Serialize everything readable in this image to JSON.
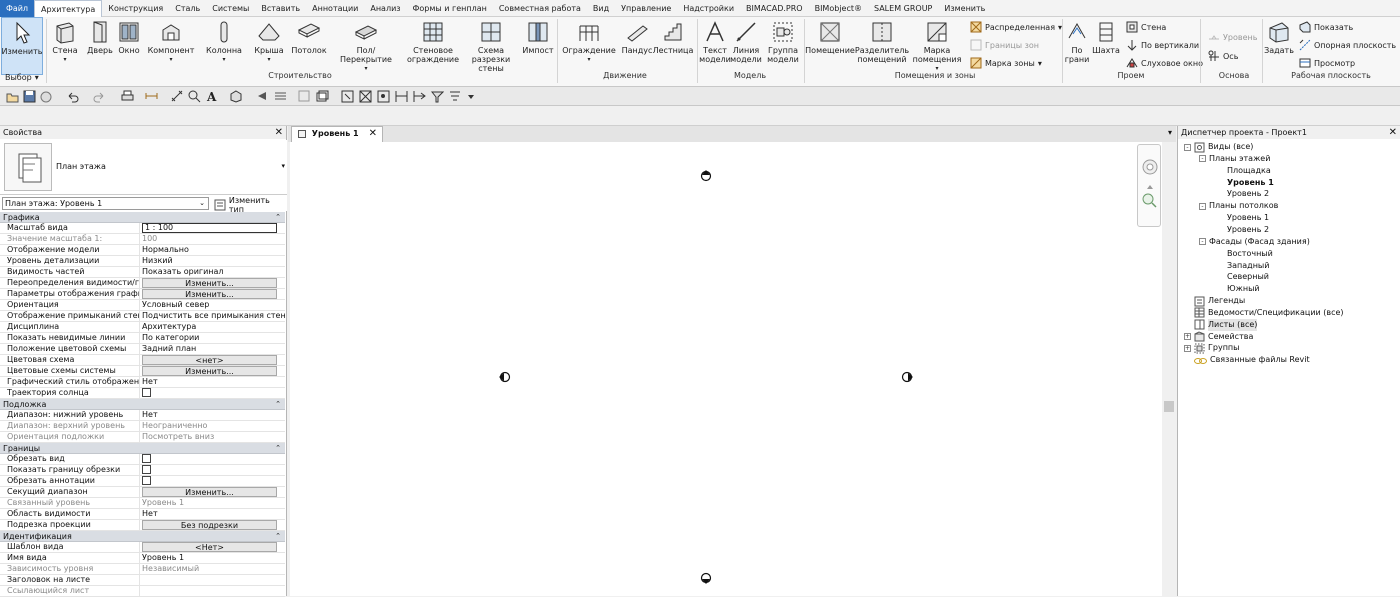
{
  "menu": {
    "file": "Файл",
    "tabs": [
      "Архитектура",
      "Конструкция",
      "Сталь",
      "Системы",
      "Вставить",
      "Аннотации",
      "Анализ",
      "Формы и генплан",
      "Совместная работа",
      "Вид",
      "Управление",
      "Надстройки",
      "BIMACAD.PRO",
      "BIMobject®",
      "SALEM GROUP",
      "Изменить"
    ],
    "active_tab": "Архитектура"
  },
  "ribbon": {
    "modify": "Изменить",
    "select": "Выбор",
    "build": {
      "wall": "Стена",
      "door": "Дверь",
      "window": "Окно",
      "component": "Компонент",
      "column": "Колонна",
      "roof": "Крыша",
      "ceiling": "Потолок",
      "floor": "Пол/Перекрытие",
      "curtain_system": "Стеновое\nограждение",
      "curtain_grid": "Схема разрезки\nстены",
      "mullion": "Импост",
      "panel": "Строительство"
    },
    "circulation": {
      "railing": "Ограждение",
      "ramp": "Пандус",
      "stair": "Лестница",
      "panel": "Движение"
    },
    "model": {
      "model_text": "Текст\nмодели",
      "model_line": "Линия\nмодели",
      "model_group": "Группа\nмодели",
      "panel": "Модель"
    },
    "room": {
      "room": "Помещение",
      "separator": "Разделитель\nпомещений",
      "tag_room": "Марка\nпомещения",
      "area": "Распределенная",
      "area_boundary": "Границы зон",
      "tag_area": "Марка зоны",
      "panel": "Помещения и зоны"
    },
    "opening": {
      "by_face": "По\nграни",
      "shaft": "Шахта",
      "wall": "Стена",
      "vertical": "По вертикали",
      "dormer": "Слуховое окно",
      "panel": "Проем"
    },
    "datum": {
      "level": "Уровень",
      "grid": "Ось",
      "panel": "Основа"
    },
    "workplane": {
      "set": "Задать",
      "show": "Показать",
      "ref_plane": "Опорная плоскость",
      "viewer": "Просмотр",
      "panel": "Рабочая плоскость"
    }
  },
  "properties": {
    "title": "Свойства",
    "type_name": "План этажа",
    "instance_selector": "План этажа: Уровень 1",
    "edit_type": "Изменить тип",
    "sections": [
      {
        "name": "Графика",
        "rows": [
          {
            "name": "Масштаб вида",
            "value": "1 : 100",
            "kind": "input"
          },
          {
            "name": "Значение масштаба    1:",
            "value": "100",
            "kind": "text",
            "disabled": true
          },
          {
            "name": "Отображение модели",
            "value": "Нормально",
            "kind": "text"
          },
          {
            "name": "Уровень детализации",
            "value": "Низкий",
            "kind": "text"
          },
          {
            "name": "Видимость частей",
            "value": "Показать оригинал",
            "kind": "text"
          },
          {
            "name": "Переопределения видимости/гр...",
            "value": "Изменить...",
            "kind": "button"
          },
          {
            "name": "Параметры отображения графики",
            "value": "Изменить...",
            "kind": "button"
          },
          {
            "name": "Ориентация",
            "value": "Условный север",
            "kind": "text"
          },
          {
            "name": "Отображение примыканий стен",
            "value": "Подчистить все примыкания стен",
            "kind": "text"
          },
          {
            "name": "Дисциплина",
            "value": "Архитектура",
            "kind": "text"
          },
          {
            "name": "Показать невидимые линии",
            "value": "По категории",
            "kind": "text"
          },
          {
            "name": "Положение цветовой схемы",
            "value": "Задний план",
            "kind": "text"
          },
          {
            "name": "Цветовая схема",
            "value": "<нет>",
            "kind": "button"
          },
          {
            "name": "Цветовые схемы системы",
            "value": "Изменить...",
            "kind": "button"
          },
          {
            "name": "Графический стиль отображени...",
            "value": "Нет",
            "kind": "text"
          },
          {
            "name": "Траектория солнца",
            "value": "",
            "kind": "checkbox"
          }
        ]
      },
      {
        "name": "Подложка",
        "rows": [
          {
            "name": "Диапазон: нижний уровень",
            "value": "Нет",
            "kind": "text"
          },
          {
            "name": "Диапазон: верхний уровень",
            "value": "Неограниченно",
            "kind": "text",
            "disabled": true
          },
          {
            "name": "Ориентация подложки",
            "value": "Посмотреть вниз",
            "kind": "text",
            "disabled": true
          }
        ]
      },
      {
        "name": "Границы",
        "rows": [
          {
            "name": "Обрезать вид",
            "value": "",
            "kind": "checkbox"
          },
          {
            "name": "Показать границу обрезки",
            "value": "",
            "kind": "checkbox"
          },
          {
            "name": "Обрезать аннотации",
            "value": "",
            "kind": "checkbox"
          },
          {
            "name": "Секущий диапазон",
            "value": "Изменить...",
            "kind": "button"
          },
          {
            "name": "Связанный уровень",
            "value": "Уровень 1",
            "kind": "text",
            "disabled": true
          },
          {
            "name": "Область видимости",
            "value": "Нет",
            "kind": "text"
          },
          {
            "name": "Подрезка проекции",
            "value": "Без подрезки",
            "kind": "button"
          }
        ]
      },
      {
        "name": "Идентификация",
        "rows": [
          {
            "name": "Шаблон вида",
            "value": "<Нет>",
            "kind": "button"
          },
          {
            "name": "Имя вида",
            "value": "Уровень 1",
            "kind": "text"
          },
          {
            "name": "Зависимость уровня",
            "value": "Независимый",
            "kind": "text",
            "disabled": true
          },
          {
            "name": "Заголовок на листе",
            "value": "",
            "kind": "text"
          },
          {
            "name": "Ссылающийся лист",
            "value": "",
            "kind": "text",
            "disabled": true
          }
        ]
      }
    ]
  },
  "view": {
    "tab": "Уровень 1"
  },
  "browser": {
    "title": "Диспетчер проекта - Проект1",
    "tree": [
      {
        "label": "Виды (все)",
        "depth": 0,
        "exp": "-",
        "icon": "views"
      },
      {
        "label": "Планы этажей",
        "depth": 1,
        "exp": "-"
      },
      {
        "label": "Площадка",
        "depth": 2
      },
      {
        "label": "Уровень 1",
        "depth": 2,
        "bold": true
      },
      {
        "label": "Уровень 2",
        "depth": 2
      },
      {
        "label": "Планы потолков",
        "depth": 1,
        "exp": "-"
      },
      {
        "label": "Уровень 1",
        "depth": 2
      },
      {
        "label": "Уровень 2",
        "depth": 2
      },
      {
        "label": "Фасады (Фасад здания)",
        "depth": 1,
        "exp": "-"
      },
      {
        "label": "Восточный",
        "depth": 2
      },
      {
        "label": "Западный",
        "depth": 2
      },
      {
        "label": "Северный",
        "depth": 2
      },
      {
        "label": "Южный",
        "depth": 2
      },
      {
        "label": "Легенды",
        "depth": 0,
        "icon": "legend"
      },
      {
        "label": "Ведомости/Спецификации (все)",
        "depth": 0,
        "icon": "schedule"
      },
      {
        "label": "Листы (все)",
        "depth": 0,
        "icon": "sheet",
        "selected": true
      },
      {
        "label": "Семейства",
        "depth": 0,
        "exp": "+",
        "icon": "family"
      },
      {
        "label": "Группы",
        "depth": 0,
        "exp": "+",
        "icon": "group"
      },
      {
        "label": "Связанные файлы Revit",
        "depth": 0,
        "icon": "link"
      }
    ]
  },
  "colors": {
    "accent": "#2b6fbf",
    "section_bg": "#d9dde3",
    "selection": "#cfe3f7"
  }
}
